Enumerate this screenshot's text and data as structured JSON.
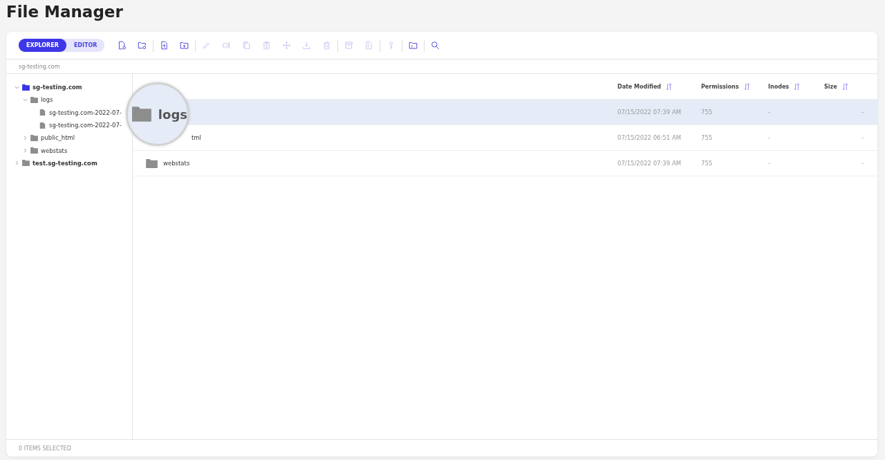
{
  "page_title": "File Manager",
  "toolbar": {
    "modes": [
      {
        "label": "EXPLORER",
        "selected": true
      },
      {
        "label": "EDITOR",
        "selected": false
      }
    ],
    "groups": [
      [
        {
          "kind": "new-file",
          "disabled": false
        },
        {
          "kind": "new-folder",
          "disabled": false
        }
      ],
      [
        {
          "kind": "upload-file",
          "disabled": false
        },
        {
          "kind": "upload-folder",
          "disabled": false
        }
      ],
      [
        {
          "kind": "edit",
          "disabled": true
        },
        {
          "kind": "rename",
          "disabled": true
        },
        {
          "kind": "copy",
          "disabled": true
        },
        {
          "kind": "paste",
          "disabled": true
        },
        {
          "kind": "move",
          "disabled": true
        },
        {
          "kind": "download",
          "disabled": true
        },
        {
          "kind": "delete",
          "disabled": true
        }
      ],
      [
        {
          "kind": "archive",
          "disabled": true
        },
        {
          "kind": "extract",
          "disabled": true
        }
      ],
      [
        {
          "kind": "key",
          "disabled": true
        }
      ],
      [
        {
          "kind": "folder-info",
          "disabled": false
        }
      ],
      [
        {
          "kind": "search",
          "disabled": false
        }
      ]
    ]
  },
  "breadcrumb": "sg-testing.com",
  "tree": [
    {
      "name": "sg-testing.com",
      "kind": "folder",
      "selected": true,
      "expanded": true,
      "children": [
        {
          "name": "logs",
          "kind": "folder",
          "selected": false,
          "expanded": true,
          "children": [
            {
              "name": "sg-testing.com-2022-07-",
              "kind": "file",
              "selected": false
            },
            {
              "name": "sg-testing.com-2022-07-",
              "kind": "file",
              "selected": false
            }
          ]
        },
        {
          "name": "public_html",
          "kind": "folder",
          "selected": false,
          "expanded": false
        },
        {
          "name": "webstats",
          "kind": "folder",
          "selected": false,
          "expanded": false
        }
      ]
    },
    {
      "name": "test.sg-testing.com",
      "kind": "folder",
      "selected": false,
      "expanded": false
    }
  ],
  "table": {
    "columns": [
      "Date Modified",
      "Permissions",
      "Inodes",
      "Size"
    ],
    "rows": [
      {
        "name": "logs",
        "magnified": true,
        "selected": true,
        "date": "07/15/2022 07:39 AM",
        "permissions": "755",
        "inodes": "-",
        "size": "-"
      },
      {
        "name": "tml",
        "magnified": false,
        "selected": false,
        "date": "07/15/2022 06:51 AM",
        "permissions": "755",
        "inodes": "-",
        "size": "-"
      },
      {
        "name": "webstats",
        "magnified": false,
        "selected": false,
        "date": "07/15/2022 07:39 AM",
        "permissions": "755",
        "inodes": "-",
        "size": "-"
      }
    ]
  },
  "status_bar": "0 ITEMS SELECTED"
}
